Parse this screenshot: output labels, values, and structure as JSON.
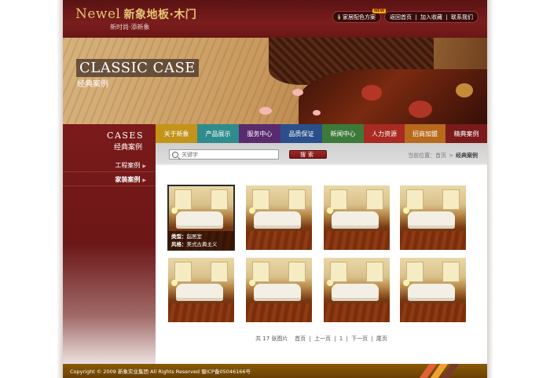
{
  "header": {
    "logo_en": "Newel",
    "logo_cn": "新象地板·木门",
    "slogan": "新时尚·添新象",
    "scheme_label": "家居配色方案",
    "scheme_badge": "NEW",
    "links": [
      "返回首页",
      "加入收藏",
      "联系我们"
    ],
    "link_separator": "|"
  },
  "banner": {
    "title_en": "CLASSIC CASE",
    "title_cn": "经典案例"
  },
  "sidebar": {
    "title_en": "CASES",
    "title_cn": "经典案例",
    "items": [
      {
        "label": "工程案例",
        "active": false
      },
      {
        "label": "家装案例",
        "active": true
      }
    ],
    "arrow_glyph": "▶"
  },
  "nav": {
    "items": [
      {
        "label": "关于新象",
        "color": "#c49319"
      },
      {
        "label": "产品展示",
        "color": "#2f8c8c"
      },
      {
        "label": "服务中心",
        "color": "#5a2a6e"
      },
      {
        "label": "品质保证",
        "color": "#2b4f8a"
      },
      {
        "label": "新闻中心",
        "color": "#3d7a3a"
      },
      {
        "label": "人力资源",
        "color": "#a82a20"
      },
      {
        "label": "招商加盟",
        "color": "#b86a1c"
      },
      {
        "label": "精典案例",
        "color": "#7a1a1a"
      }
    ]
  },
  "search": {
    "placeholder": "关键字",
    "button_label": "搜索"
  },
  "breadcrumb": {
    "prefix": "当前位置：",
    "home": "首页",
    "current": "经典案例"
  },
  "cases": {
    "caption": {
      "type_label": "类型：",
      "type_value": "起居室",
      "style_label": "风格：",
      "style_value": "美式古典主义"
    },
    "count": 8,
    "selected_index": 0
  },
  "pager": {
    "total": "共 17 张图片",
    "first": "首页",
    "prev": "上一页",
    "page": "1",
    "next": "下一页",
    "last": "尾页",
    "separator": "|"
  },
  "footer": {
    "copyright": "Copyright © 2009 新象实业集团 All Rights Reserved 蜀ICP备05046166号",
    "stripe_colors": [
      "#e0603a",
      "#f0a030",
      "#7a3a2a"
    ]
  }
}
